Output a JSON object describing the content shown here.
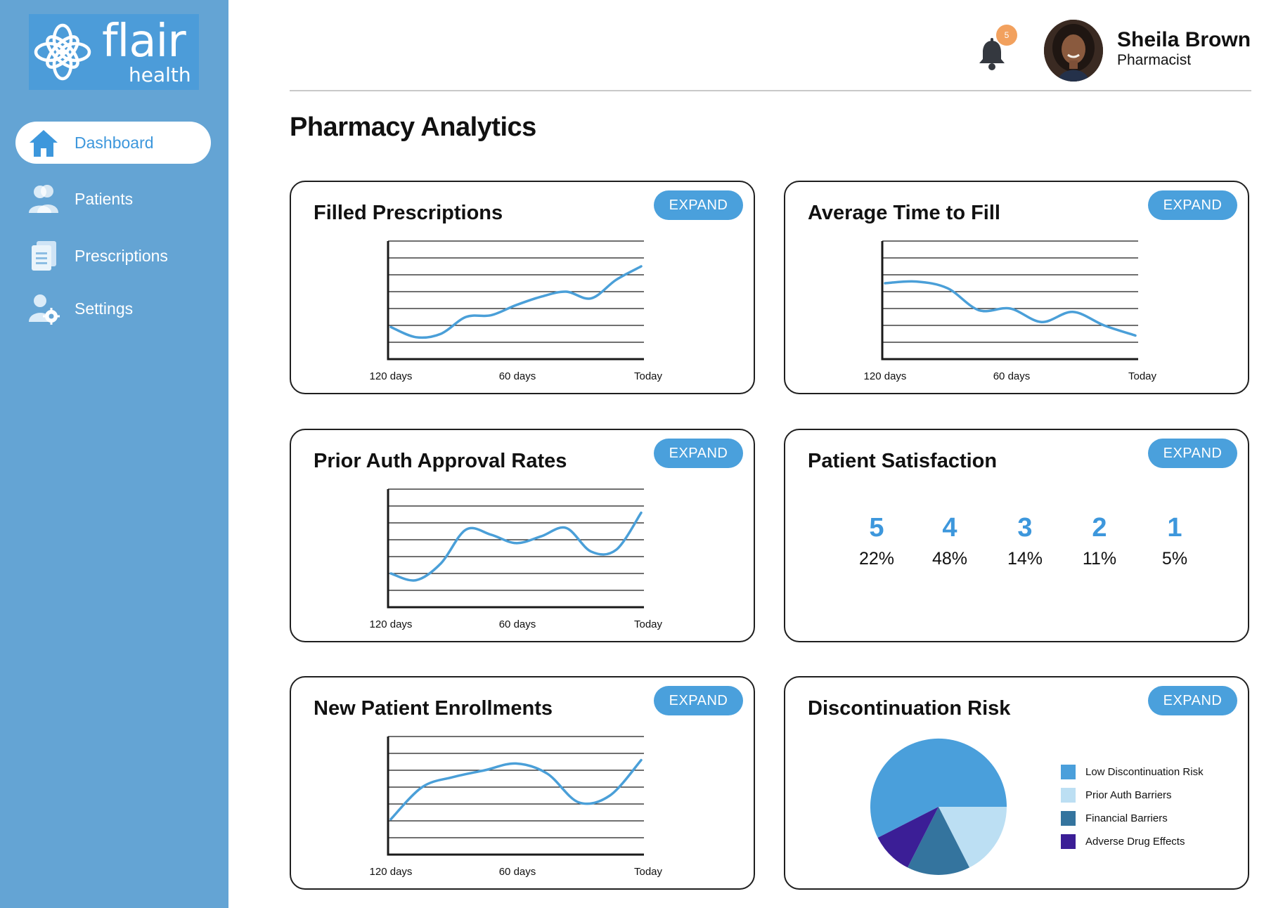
{
  "brand": {
    "name": "flair",
    "sub": "health"
  },
  "sidebar": {
    "items": [
      {
        "label": "Dashboard",
        "icon": "home-icon",
        "active": true
      },
      {
        "label": "Patients",
        "icon": "users-icon",
        "active": false
      },
      {
        "label": "Prescriptions",
        "icon": "document-icon",
        "active": false
      },
      {
        "label": "Settings",
        "icon": "user-gear-icon",
        "active": false
      }
    ]
  },
  "header": {
    "notification_count": "5",
    "user_name": "Sheila Brown",
    "user_role": "Pharmacist"
  },
  "page": {
    "title": "Pharmacy Analytics"
  },
  "cards": {
    "filled": {
      "title": "Filled Prescriptions",
      "expand": "EXPAND"
    },
    "avg_time": {
      "title": "Average Time to Fill",
      "expand": "EXPAND"
    },
    "prior_auth": {
      "title": "Prior Auth Approval Rates",
      "expand": "EXPAND"
    },
    "satisfaction": {
      "title": "Patient Satisfaction",
      "expand": "EXPAND"
    },
    "enrollments": {
      "title": "New Patient Enrollments",
      "expand": "EXPAND"
    },
    "discontinuation": {
      "title": "Discontinuation Risk",
      "expand": "EXPAND"
    }
  },
  "colors": {
    "accent": "#4aa0dc",
    "sidebar": "#64a4d4",
    "line": "#4a9fd8",
    "pie_low": "#4a9fdb",
    "pie_prior_auth": "#bcdff3",
    "pie_financial": "#34749e",
    "pie_adverse": "#3b1e96"
  },
  "chart_data": [
    {
      "type": "line",
      "title": "Filled Prescriptions",
      "x_tick_labels": [
        "120 days",
        "60 days",
        "Today"
      ],
      "ylim": [
        0,
        7
      ],
      "series": [
        {
          "values": [
            1.9,
            1.3,
            1.5,
            2.5,
            2.6,
            3.2,
            3.7,
            4.0,
            3.6,
            4.7,
            5.5
          ]
        }
      ]
    },
    {
      "type": "line",
      "title": "Average Time to Fill",
      "x_tick_labels": [
        "120 days",
        "60 days",
        "Today"
      ],
      "ylim": [
        0,
        7
      ],
      "series": [
        {
          "values": [
            4.5,
            4.6,
            4.2,
            2.9,
            3.0,
            2.2,
            2.8,
            2.0,
            1.4
          ]
        }
      ]
    },
    {
      "type": "line",
      "title": "Prior Auth Approval Rates",
      "x_tick_labels": [
        "120 days",
        "60 days",
        "Today"
      ],
      "ylim": [
        0,
        7
      ],
      "series": [
        {
          "values": [
            2.0,
            1.6,
            2.6,
            4.6,
            4.3,
            3.8,
            4.2,
            4.7,
            3.3,
            3.4,
            5.6
          ]
        }
      ]
    },
    {
      "type": "table",
      "title": "Patient Satisfaction",
      "categories": [
        "5",
        "4",
        "3",
        "2",
        "1"
      ],
      "values": [
        "22%",
        "48%",
        "14%",
        "11%",
        "5%"
      ]
    },
    {
      "type": "line",
      "title": "New Patient Enrollments",
      "x_tick_labels": [
        "120 days",
        "60 days",
        "Today"
      ],
      "ylim": [
        0,
        7
      ],
      "series": [
        {
          "values": [
            2.1,
            4.0,
            4.6,
            5.0,
            5.4,
            4.8,
            3.1,
            3.5,
            5.6
          ]
        }
      ]
    },
    {
      "type": "pie",
      "title": "Discontinuation Risk",
      "labels": [
        "Low Discontinuation Risk",
        "Prior Auth Barriers",
        "Financial Barriers",
        "Adverse Drug Effects"
      ],
      "values": [
        57.5,
        17.5,
        15,
        10
      ]
    }
  ]
}
